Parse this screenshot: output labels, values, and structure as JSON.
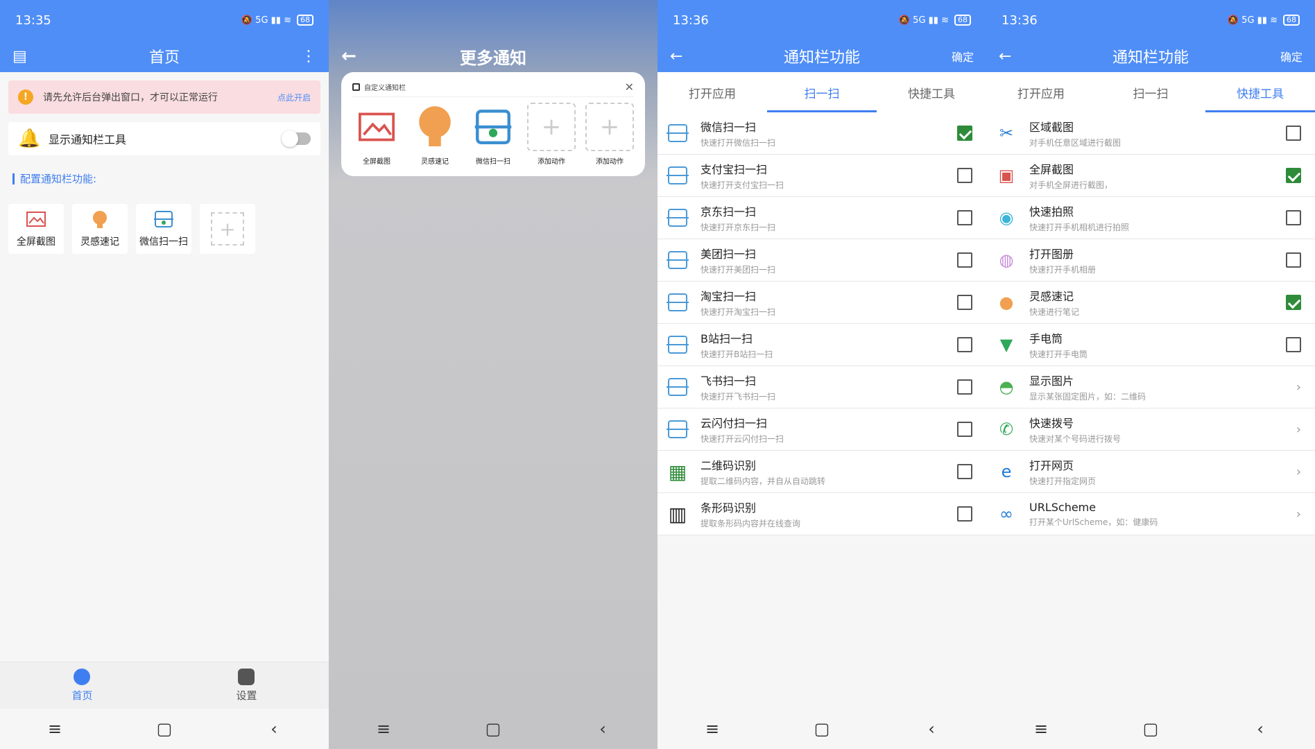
{
  "p1": {
    "time": "13:35",
    "status_right": "5G",
    "battery": "68",
    "title": "首页",
    "warn_text": "请先允许后台弹出窗口，才可以正常运行",
    "warn_link": "点此开启",
    "toggle_label": "显示通知栏工具",
    "config_label": "配置通知栏功能:",
    "tiles": [
      "全屏截图",
      "灵感速记",
      "微信扫一扫"
    ],
    "tab_home": "首页",
    "tab_settings": "设置"
  },
  "p2": {
    "title": "更多通知",
    "notif_header": "自定义通知栏",
    "items": [
      "全屏截图",
      "灵感速记",
      "微信扫一扫",
      "添加动作",
      "添加动作"
    ]
  },
  "p3": {
    "time": "13:36",
    "battery": "68",
    "title": "通知栏功能",
    "confirm": "确定",
    "tabs": [
      "打开应用",
      "扫一扫",
      "快捷工具"
    ],
    "rows": [
      {
        "t": "微信扫一扫",
        "s": "快速打开微信扫一扫",
        "checked": true
      },
      {
        "t": "支付宝扫一扫",
        "s": "快速打开支付宝扫一扫",
        "checked": false
      },
      {
        "t": "京东扫一扫",
        "s": "快速打开京东扫一扫",
        "checked": false
      },
      {
        "t": "美团扫一扫",
        "s": "快速打开美团扫一扫",
        "checked": false
      },
      {
        "t": "淘宝扫一扫",
        "s": "快速打开淘宝扫一扫",
        "checked": false
      },
      {
        "t": "B站扫一扫",
        "s": "快速打开B站扫一扫",
        "checked": false
      },
      {
        "t": "飞书扫一扫",
        "s": "快速打开飞书扫一扫",
        "checked": false
      },
      {
        "t": "云闪付扫一扫",
        "s": "快速打开云闪付扫一扫",
        "checked": false
      },
      {
        "t": "二维码识别",
        "s": "提取二维码内容，并自从自动跳转",
        "checked": false
      },
      {
        "t": "条形码识别",
        "s": "提取条形码内容并在线查询",
        "checked": false
      }
    ]
  },
  "p4": {
    "time": "13:36",
    "battery": "68",
    "title": "通知栏功能",
    "confirm": "确定",
    "tabs": [
      "打开应用",
      "扫一扫",
      "快捷工具"
    ],
    "rows": [
      {
        "t": "区域截图",
        "s": "对手机任意区域进行截图",
        "kind": "check",
        "checked": false
      },
      {
        "t": "全屏截图",
        "s": "对手机全屏进行截图，",
        "kind": "check",
        "checked": true
      },
      {
        "t": "快速拍照",
        "s": "快速打开手机相机进行拍照",
        "kind": "check",
        "checked": false
      },
      {
        "t": "打开图册",
        "s": "快速打开手机相册",
        "kind": "check",
        "checked": false
      },
      {
        "t": "灵感速记",
        "s": "快速进行笔记",
        "kind": "check",
        "checked": true
      },
      {
        "t": "手电筒",
        "s": "快速打开手电筒",
        "kind": "check",
        "checked": false
      },
      {
        "t": "显示图片",
        "s": "显示某张固定图片，如：二维码",
        "kind": "arrow"
      },
      {
        "t": "快速拨号",
        "s": "快速对某个号码进行拨号",
        "kind": "arrow"
      },
      {
        "t": "打开网页",
        "s": "快速打开指定网页",
        "kind": "arrow"
      },
      {
        "t": "URLScheme",
        "s": "打开某个UrlScheme，如：健康码",
        "kind": "arrow"
      }
    ]
  }
}
